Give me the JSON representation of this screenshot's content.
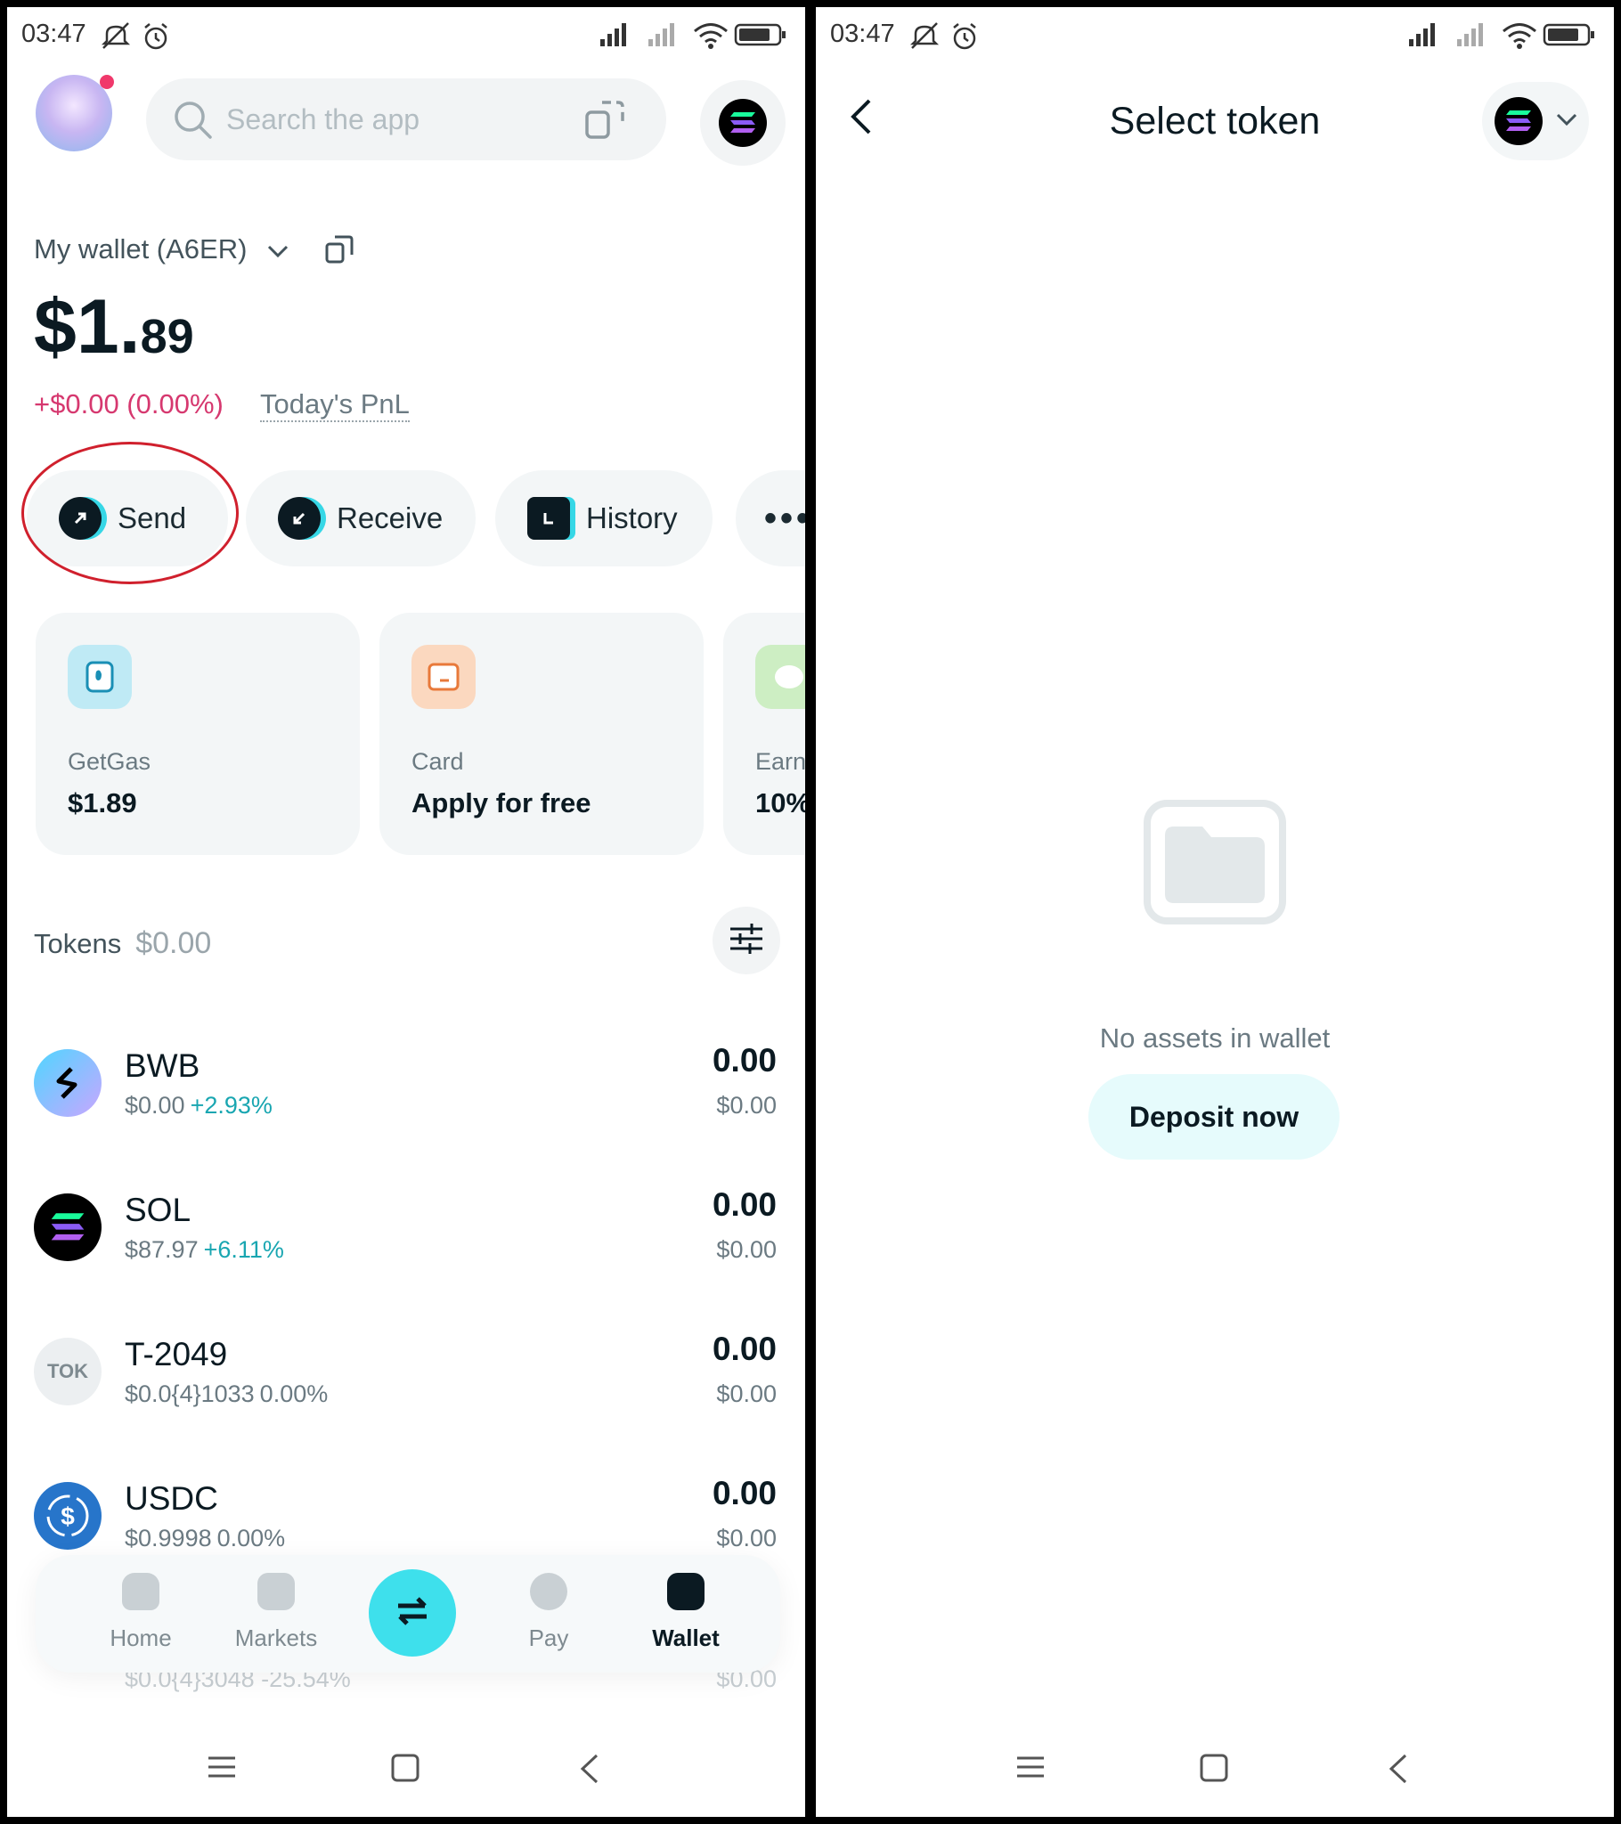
{
  "status_bar": {
    "time": "03:47",
    "battery": "78"
  },
  "left": {
    "search_placeholder": "Search the app",
    "wallet_name": "My wallet (A6ER)",
    "balance_main": "$1.",
    "balance_cents": "89",
    "pnl_value": "+$0.00 (0.00%)",
    "pnl_label": "Today's PnL",
    "actions": {
      "send": "Send",
      "receive": "Receive",
      "history": "History"
    },
    "cards": [
      {
        "label": "GetGas",
        "value": "$1.89"
      },
      {
        "label": "Card",
        "value": "Apply for free"
      },
      {
        "label": "Earn",
        "value": "10%"
      }
    ],
    "tokens_title": "Tokens",
    "tokens_total": "$0.00",
    "tokens": [
      {
        "symbol": "BWB",
        "price": "$0.00",
        "change": "+2.93%",
        "amount": "0.00",
        "usd": "$0.00"
      },
      {
        "symbol": "SOL",
        "price": "$87.97",
        "change": "+6.11%",
        "amount": "0.00",
        "usd": "$0.00"
      },
      {
        "symbol": "T-2049",
        "logo_text": "TOK",
        "price": "$0.0{4}1033",
        "change": "0.00%",
        "amount": "0.00",
        "usd": "$0.00"
      },
      {
        "symbol": "USDC",
        "price": "$0.9998",
        "change": "0.00%",
        "amount": "0.00",
        "usd": "$0.00"
      }
    ],
    "hidden_row": {
      "sub": "$0.0{4}3048 -25.54%",
      "usd": "$0.00"
    },
    "nav": {
      "home": "Home",
      "markets": "Markets",
      "pay": "Pay",
      "wallet": "Wallet"
    }
  },
  "right": {
    "title": "Select token",
    "empty_message": "No assets in wallet",
    "deposit_label": "Deposit now"
  },
  "colors": {
    "accent": "#3ee0ec",
    "negative": "#d6386f",
    "positive": "#19a6b1",
    "annotation": "#d0202d"
  }
}
